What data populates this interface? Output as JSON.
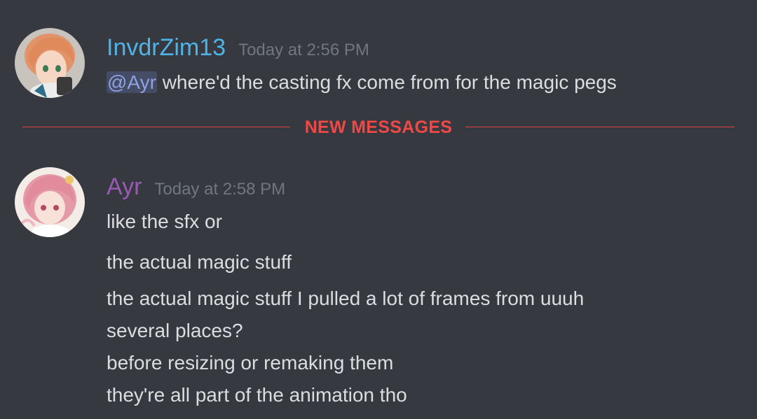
{
  "divider": {
    "label": "NEW MESSAGES",
    "color": "#f04747"
  },
  "messages": [
    {
      "username": "InvdrZim13",
      "username_color": "#4fb3e8",
      "timestamp": "Today at 2:56 PM",
      "mention": "@Ayr",
      "text": "where'd the casting fx come from for the magic pegs",
      "avatar_icon": "orange-haired-anime-avatar"
    },
    {
      "username": "Ayr",
      "username_color": "#9b59b6",
      "timestamp": "Today at 2:58 PM",
      "avatar_icon": "pink-haired-anime-avatar",
      "lines": [
        "like the sfx or",
        "the actual magic stuff",
        "the actual magic stuff I pulled a lot of frames from uuuh",
        "several places?",
        "before resizing or remaking them",
        "they're all part of the animation tho"
      ]
    }
  ]
}
